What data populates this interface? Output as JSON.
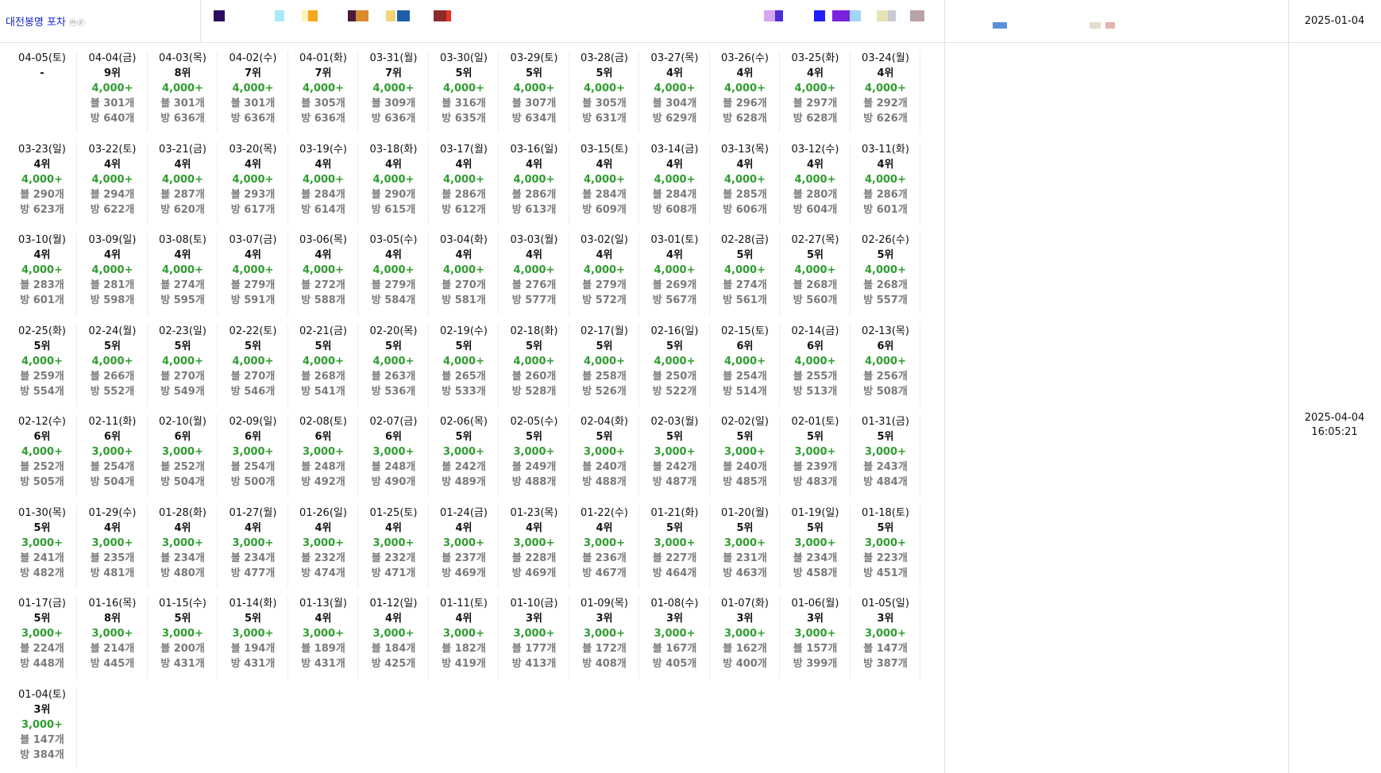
{
  "header": {
    "title": "대전봉명 포차",
    "title_suffix": "ⓜⓟ",
    "date": "2025-01-04",
    "swatches": [
      "#2b0f5e",
      "#a8eaf5",
      "#fff3b8",
      "#f5a623",
      "#4a1a3d",
      "#d98b2e",
      "#f0d57a",
      "#1e5faa",
      "#8c2a2a",
      "#e5332a",
      "#d7a6f0",
      "#4a2fd8",
      "#2020ff",
      "#7a22e0",
      "#9fd6f7",
      "#e7e3b6",
      "#c8ccd2",
      "#b8a3a7",
      "#5d8fd6",
      "#e5dccc",
      "#e3b3ad"
    ]
  },
  "side": {
    "date": "2025-04-04",
    "time": "16:05:21"
  },
  "entries": [
    {
      "date": "04-05(토)",
      "rank": "-",
      "val": "",
      "blog": "",
      "bang": ""
    },
    {
      "date": "04-04(금)",
      "rank": "9위",
      "val": "4,000+",
      "blog": "블 301개",
      "bang": "방 640개"
    },
    {
      "date": "04-03(목)",
      "rank": "8위",
      "val": "4,000+",
      "blog": "블 301개",
      "bang": "방 636개"
    },
    {
      "date": "04-02(수)",
      "rank": "7위",
      "val": "4,000+",
      "blog": "블 301개",
      "bang": "방 636개"
    },
    {
      "date": "04-01(화)",
      "rank": "7위",
      "val": "4,000+",
      "blog": "블 305개",
      "bang": "방 636개"
    },
    {
      "date": "03-31(월)",
      "rank": "7위",
      "val": "4,000+",
      "blog": "블 309개",
      "bang": "방 636개"
    },
    {
      "date": "03-30(일)",
      "rank": "5위",
      "val": "4,000+",
      "blog": "블 316개",
      "bang": "방 635개"
    },
    {
      "date": "03-29(토)",
      "rank": "5위",
      "val": "4,000+",
      "blog": "블 307개",
      "bang": "방 634개"
    },
    {
      "date": "03-28(금)",
      "rank": "5위",
      "val": "4,000+",
      "blog": "블 305개",
      "bang": "방 631개"
    },
    {
      "date": "03-27(목)",
      "rank": "4위",
      "val": "4,000+",
      "blog": "블 304개",
      "bang": "방 629개"
    },
    {
      "date": "03-26(수)",
      "rank": "4위",
      "val": "4,000+",
      "blog": "블 296개",
      "bang": "방 628개"
    },
    {
      "date": "03-25(화)",
      "rank": "4위",
      "val": "4,000+",
      "blog": "블 297개",
      "bang": "방 628개"
    },
    {
      "date": "03-24(월)",
      "rank": "4위",
      "val": "4,000+",
      "blog": "블 292개",
      "bang": "방 626개"
    },
    {
      "date": "03-23(일)",
      "rank": "4위",
      "val": "4,000+",
      "blog": "블 290개",
      "bang": "방 623개"
    },
    {
      "date": "03-22(토)",
      "rank": "4위",
      "val": "4,000+",
      "blog": "블 294개",
      "bang": "방 622개"
    },
    {
      "date": "03-21(금)",
      "rank": "4위",
      "val": "4,000+",
      "blog": "블 287개",
      "bang": "방 620개"
    },
    {
      "date": "03-20(목)",
      "rank": "4위",
      "val": "4,000+",
      "blog": "블 293개",
      "bang": "방 617개"
    },
    {
      "date": "03-19(수)",
      "rank": "4위",
      "val": "4,000+",
      "blog": "블 284개",
      "bang": "방 614개"
    },
    {
      "date": "03-18(화)",
      "rank": "4위",
      "val": "4,000+",
      "blog": "블 290개",
      "bang": "방 615개"
    },
    {
      "date": "03-17(월)",
      "rank": "4위",
      "val": "4,000+",
      "blog": "블 286개",
      "bang": "방 612개"
    },
    {
      "date": "03-16(일)",
      "rank": "4위",
      "val": "4,000+",
      "blog": "블 286개",
      "bang": "방 613개"
    },
    {
      "date": "03-15(토)",
      "rank": "4위",
      "val": "4,000+",
      "blog": "블 284개",
      "bang": "방 609개"
    },
    {
      "date": "03-14(금)",
      "rank": "4위",
      "val": "4,000+",
      "blog": "블 284개",
      "bang": "방 608개"
    },
    {
      "date": "03-13(목)",
      "rank": "4위",
      "val": "4,000+",
      "blog": "블 285개",
      "bang": "방 606개"
    },
    {
      "date": "03-12(수)",
      "rank": "4위",
      "val": "4,000+",
      "blog": "블 280개",
      "bang": "방 604개"
    },
    {
      "date": "03-11(화)",
      "rank": "4위",
      "val": "4,000+",
      "blog": "블 286개",
      "bang": "방 601개"
    },
    {
      "date": "03-10(월)",
      "rank": "4위",
      "val": "4,000+",
      "blog": "블 283개",
      "bang": "방 601개"
    },
    {
      "date": "03-09(일)",
      "rank": "4위",
      "val": "4,000+",
      "blog": "블 281개",
      "bang": "방 598개"
    },
    {
      "date": "03-08(토)",
      "rank": "4위",
      "val": "4,000+",
      "blog": "블 274개",
      "bang": "방 595개"
    },
    {
      "date": "03-07(금)",
      "rank": "4위",
      "val": "4,000+",
      "blog": "블 279개",
      "bang": "방 591개"
    },
    {
      "date": "03-06(목)",
      "rank": "4위",
      "val": "4,000+",
      "blog": "블 272개",
      "bang": "방 588개"
    },
    {
      "date": "03-05(수)",
      "rank": "4위",
      "val": "4,000+",
      "blog": "블 279개",
      "bang": "방 584개"
    },
    {
      "date": "03-04(화)",
      "rank": "4위",
      "val": "4,000+",
      "blog": "블 270개",
      "bang": "방 581개"
    },
    {
      "date": "03-03(월)",
      "rank": "4위",
      "val": "4,000+",
      "blog": "블 276개",
      "bang": "방 577개"
    },
    {
      "date": "03-02(일)",
      "rank": "4위",
      "val": "4,000+",
      "blog": "블 279개",
      "bang": "방 572개"
    },
    {
      "date": "03-01(토)",
      "rank": "4위",
      "val": "4,000+",
      "blog": "블 269개",
      "bang": "방 567개"
    },
    {
      "date": "02-28(금)",
      "rank": "5위",
      "val": "4,000+",
      "blog": "블 274개",
      "bang": "방 561개"
    },
    {
      "date": "02-27(목)",
      "rank": "5위",
      "val": "4,000+",
      "blog": "블 268개",
      "bang": "방 560개"
    },
    {
      "date": "02-26(수)",
      "rank": "5위",
      "val": "4,000+",
      "blog": "블 268개",
      "bang": "방 557개"
    },
    {
      "date": "02-25(화)",
      "rank": "5위",
      "val": "4,000+",
      "blog": "블 259개",
      "bang": "방 554개"
    },
    {
      "date": "02-24(월)",
      "rank": "5위",
      "val": "4,000+",
      "blog": "블 266개",
      "bang": "방 552개"
    },
    {
      "date": "02-23(일)",
      "rank": "5위",
      "val": "4,000+",
      "blog": "블 270개",
      "bang": "방 549개"
    },
    {
      "date": "02-22(토)",
      "rank": "5위",
      "val": "4,000+",
      "blog": "블 270개",
      "bang": "방 546개"
    },
    {
      "date": "02-21(금)",
      "rank": "5위",
      "val": "4,000+",
      "blog": "블 268개",
      "bang": "방 541개"
    },
    {
      "date": "02-20(목)",
      "rank": "5위",
      "val": "4,000+",
      "blog": "블 263개",
      "bang": "방 536개"
    },
    {
      "date": "02-19(수)",
      "rank": "5위",
      "val": "4,000+",
      "blog": "블 265개",
      "bang": "방 533개"
    },
    {
      "date": "02-18(화)",
      "rank": "5위",
      "val": "4,000+",
      "blog": "블 260개",
      "bang": "방 528개"
    },
    {
      "date": "02-17(월)",
      "rank": "5위",
      "val": "4,000+",
      "blog": "블 258개",
      "bang": "방 526개"
    },
    {
      "date": "02-16(일)",
      "rank": "5위",
      "val": "4,000+",
      "blog": "블 250개",
      "bang": "방 522개"
    },
    {
      "date": "02-15(토)",
      "rank": "6위",
      "val": "4,000+",
      "blog": "블 254개",
      "bang": "방 514개"
    },
    {
      "date": "02-14(금)",
      "rank": "6위",
      "val": "4,000+",
      "blog": "블 255개",
      "bang": "방 513개"
    },
    {
      "date": "02-13(목)",
      "rank": "6위",
      "val": "4,000+",
      "blog": "블 256개",
      "bang": "방 508개"
    },
    {
      "date": "02-12(수)",
      "rank": "6위",
      "val": "4,000+",
      "blog": "블 252개",
      "bang": "방 505개"
    },
    {
      "date": "02-11(화)",
      "rank": "6위",
      "val": "3,000+",
      "blog": "블 254개",
      "bang": "방 504개"
    },
    {
      "date": "02-10(월)",
      "rank": "6위",
      "val": "3,000+",
      "blog": "블 252개",
      "bang": "방 504개"
    },
    {
      "date": "02-09(일)",
      "rank": "6위",
      "val": "3,000+",
      "blog": "블 254개",
      "bang": "방 500개"
    },
    {
      "date": "02-08(토)",
      "rank": "6위",
      "val": "3,000+",
      "blog": "블 248개",
      "bang": "방 492개"
    },
    {
      "date": "02-07(금)",
      "rank": "6위",
      "val": "3,000+",
      "blog": "블 248개",
      "bang": "방 490개"
    },
    {
      "date": "02-06(목)",
      "rank": "5위",
      "val": "3,000+",
      "blog": "블 242개",
      "bang": "방 489개"
    },
    {
      "date": "02-05(수)",
      "rank": "5위",
      "val": "3,000+",
      "blog": "블 249개",
      "bang": "방 488개"
    },
    {
      "date": "02-04(화)",
      "rank": "5위",
      "val": "3,000+",
      "blog": "블 240개",
      "bang": "방 488개"
    },
    {
      "date": "02-03(월)",
      "rank": "5위",
      "val": "3,000+",
      "blog": "블 242개",
      "bang": "방 487개"
    },
    {
      "date": "02-02(일)",
      "rank": "5위",
      "val": "3,000+",
      "blog": "블 240개",
      "bang": "방 485개"
    },
    {
      "date": "02-01(토)",
      "rank": "5위",
      "val": "3,000+",
      "blog": "블 239개",
      "bang": "방 483개"
    },
    {
      "date": "01-31(금)",
      "rank": "5위",
      "val": "3,000+",
      "blog": "블 243개",
      "bang": "방 484개"
    },
    {
      "date": "01-30(목)",
      "rank": "5위",
      "val": "3,000+",
      "blog": "블 241개",
      "bang": "방 482개"
    },
    {
      "date": "01-29(수)",
      "rank": "4위",
      "val": "3,000+",
      "blog": "블 235개",
      "bang": "방 481개"
    },
    {
      "date": "01-28(화)",
      "rank": "4위",
      "val": "3,000+",
      "blog": "블 234개",
      "bang": "방 480개"
    },
    {
      "date": "01-27(월)",
      "rank": "4위",
      "val": "3,000+",
      "blog": "블 234개",
      "bang": "방 477개"
    },
    {
      "date": "01-26(일)",
      "rank": "4위",
      "val": "3,000+",
      "blog": "블 232개",
      "bang": "방 474개"
    },
    {
      "date": "01-25(토)",
      "rank": "4위",
      "val": "3,000+",
      "blog": "블 232개",
      "bang": "방 471개"
    },
    {
      "date": "01-24(금)",
      "rank": "4위",
      "val": "3,000+",
      "blog": "블 237개",
      "bang": "방 469개"
    },
    {
      "date": "01-23(목)",
      "rank": "4위",
      "val": "3,000+",
      "blog": "블 228개",
      "bang": "방 469개"
    },
    {
      "date": "01-22(수)",
      "rank": "4위",
      "val": "3,000+",
      "blog": "블 236개",
      "bang": "방 467개"
    },
    {
      "date": "01-21(화)",
      "rank": "5위",
      "val": "3,000+",
      "blog": "블 227개",
      "bang": "방 464개"
    },
    {
      "date": "01-20(월)",
      "rank": "5위",
      "val": "3,000+",
      "blog": "블 231개",
      "bang": "방 463개"
    },
    {
      "date": "01-19(일)",
      "rank": "5위",
      "val": "3,000+",
      "blog": "블 234개",
      "bang": "방 458개"
    },
    {
      "date": "01-18(토)",
      "rank": "5위",
      "val": "3,000+",
      "blog": "블 223개",
      "bang": "방 451개"
    },
    {
      "date": "01-17(금)",
      "rank": "5위",
      "val": "3,000+",
      "blog": "블 224개",
      "bang": "방 448개"
    },
    {
      "date": "01-16(목)",
      "rank": "8위",
      "val": "3,000+",
      "blog": "블 214개",
      "bang": "방 445개"
    },
    {
      "date": "01-15(수)",
      "rank": "5위",
      "val": "3,000+",
      "blog": "블 200개",
      "bang": "방 431개"
    },
    {
      "date": "01-14(화)",
      "rank": "5위",
      "val": "3,000+",
      "blog": "블 194개",
      "bang": "방 431개"
    },
    {
      "date": "01-13(월)",
      "rank": "4위",
      "val": "3,000+",
      "blog": "블 189개",
      "bang": "방 431개"
    },
    {
      "date": "01-12(일)",
      "rank": "4위",
      "val": "3,000+",
      "blog": "블 184개",
      "bang": "방 425개"
    },
    {
      "date": "01-11(토)",
      "rank": "4위",
      "val": "3,000+",
      "blog": "블 182개",
      "bang": "방 419개"
    },
    {
      "date": "01-10(금)",
      "rank": "3위",
      "val": "3,000+",
      "blog": "블 177개",
      "bang": "방 413개"
    },
    {
      "date": "01-09(목)",
      "rank": "3위",
      "val": "3,000+",
      "blog": "블 172개",
      "bang": "방 408개"
    },
    {
      "date": "01-08(수)",
      "rank": "3위",
      "val": "3,000+",
      "blog": "블 167개",
      "bang": "방 405개"
    },
    {
      "date": "01-07(화)",
      "rank": "3위",
      "val": "3,000+",
      "blog": "블 162개",
      "bang": "방 400개"
    },
    {
      "date": "01-06(월)",
      "rank": "3위",
      "val": "3,000+",
      "blog": "블 157개",
      "bang": "방 399개"
    },
    {
      "date": "01-05(일)",
      "rank": "3위",
      "val": "3,000+",
      "blog": "블 147개",
      "bang": "방 387개"
    },
    {
      "date": "01-04(토)",
      "rank": "3위",
      "val": "3,000+",
      "blog": "블 147개",
      "bang": "방 384개"
    }
  ]
}
